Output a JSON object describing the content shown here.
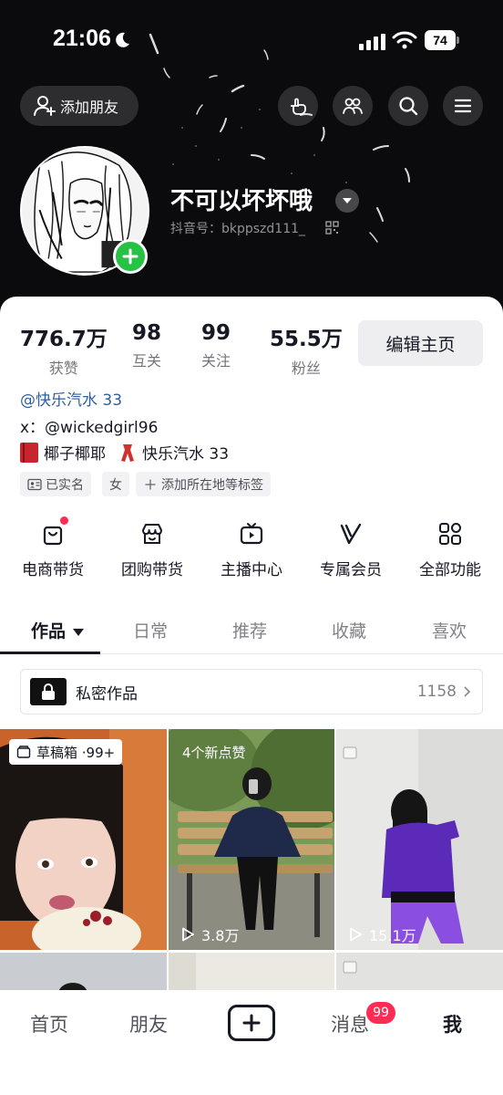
{
  "status_bar": {
    "time": "21:06",
    "battery": "74"
  },
  "header": {
    "add_friend_label": "添加朋友",
    "nickname": "不可以坏坏哦",
    "douyin_id": "抖音号：bkppszd111_"
  },
  "stats": [
    {
      "value": "776.7万",
      "label": "获赞"
    },
    {
      "value": "98",
      "label": "互关"
    },
    {
      "value": "99",
      "label": "关注"
    },
    {
      "value": "55.5万",
      "label": "粉丝"
    }
  ],
  "edit_profile_label": "编辑主页",
  "bio": {
    "mention": "@快乐汽水 33",
    "x_line": "x：@wickedgirl96",
    "emoji_line_1": "椰子椰耶",
    "emoji_line_2": "快乐汽水 33"
  },
  "tags": [
    "已实名",
    "女",
    "添加所在地等标签"
  ],
  "functions": [
    {
      "label": "电商带货",
      "icon": "shopping-bag-icon"
    },
    {
      "label": "团购带货",
      "icon": "store-icon"
    },
    {
      "label": "主播中心",
      "icon": "tv-icon"
    },
    {
      "label": "专属会员",
      "icon": "vip-icon"
    },
    {
      "label": "全部功能",
      "icon": "grid-icon"
    }
  ],
  "tabs": [
    "作品",
    "日常",
    "推荐",
    "收藏",
    "喜欢"
  ],
  "private_works": {
    "label": "私密作品",
    "count": "1158"
  },
  "grid": {
    "draft_label": "草稿箱 ·99+",
    "new_likes_label": "4个新点赞",
    "views": [
      "3.8万",
      "15.1万"
    ]
  },
  "bottom_nav": {
    "home": "首页",
    "friends": "朋友",
    "messages": "消息",
    "messages_badge": "99",
    "me": "我"
  },
  "colors": {
    "accent": "#fe2c55",
    "mention": "#2c5fa0",
    "green_plus": "#25c244"
  }
}
